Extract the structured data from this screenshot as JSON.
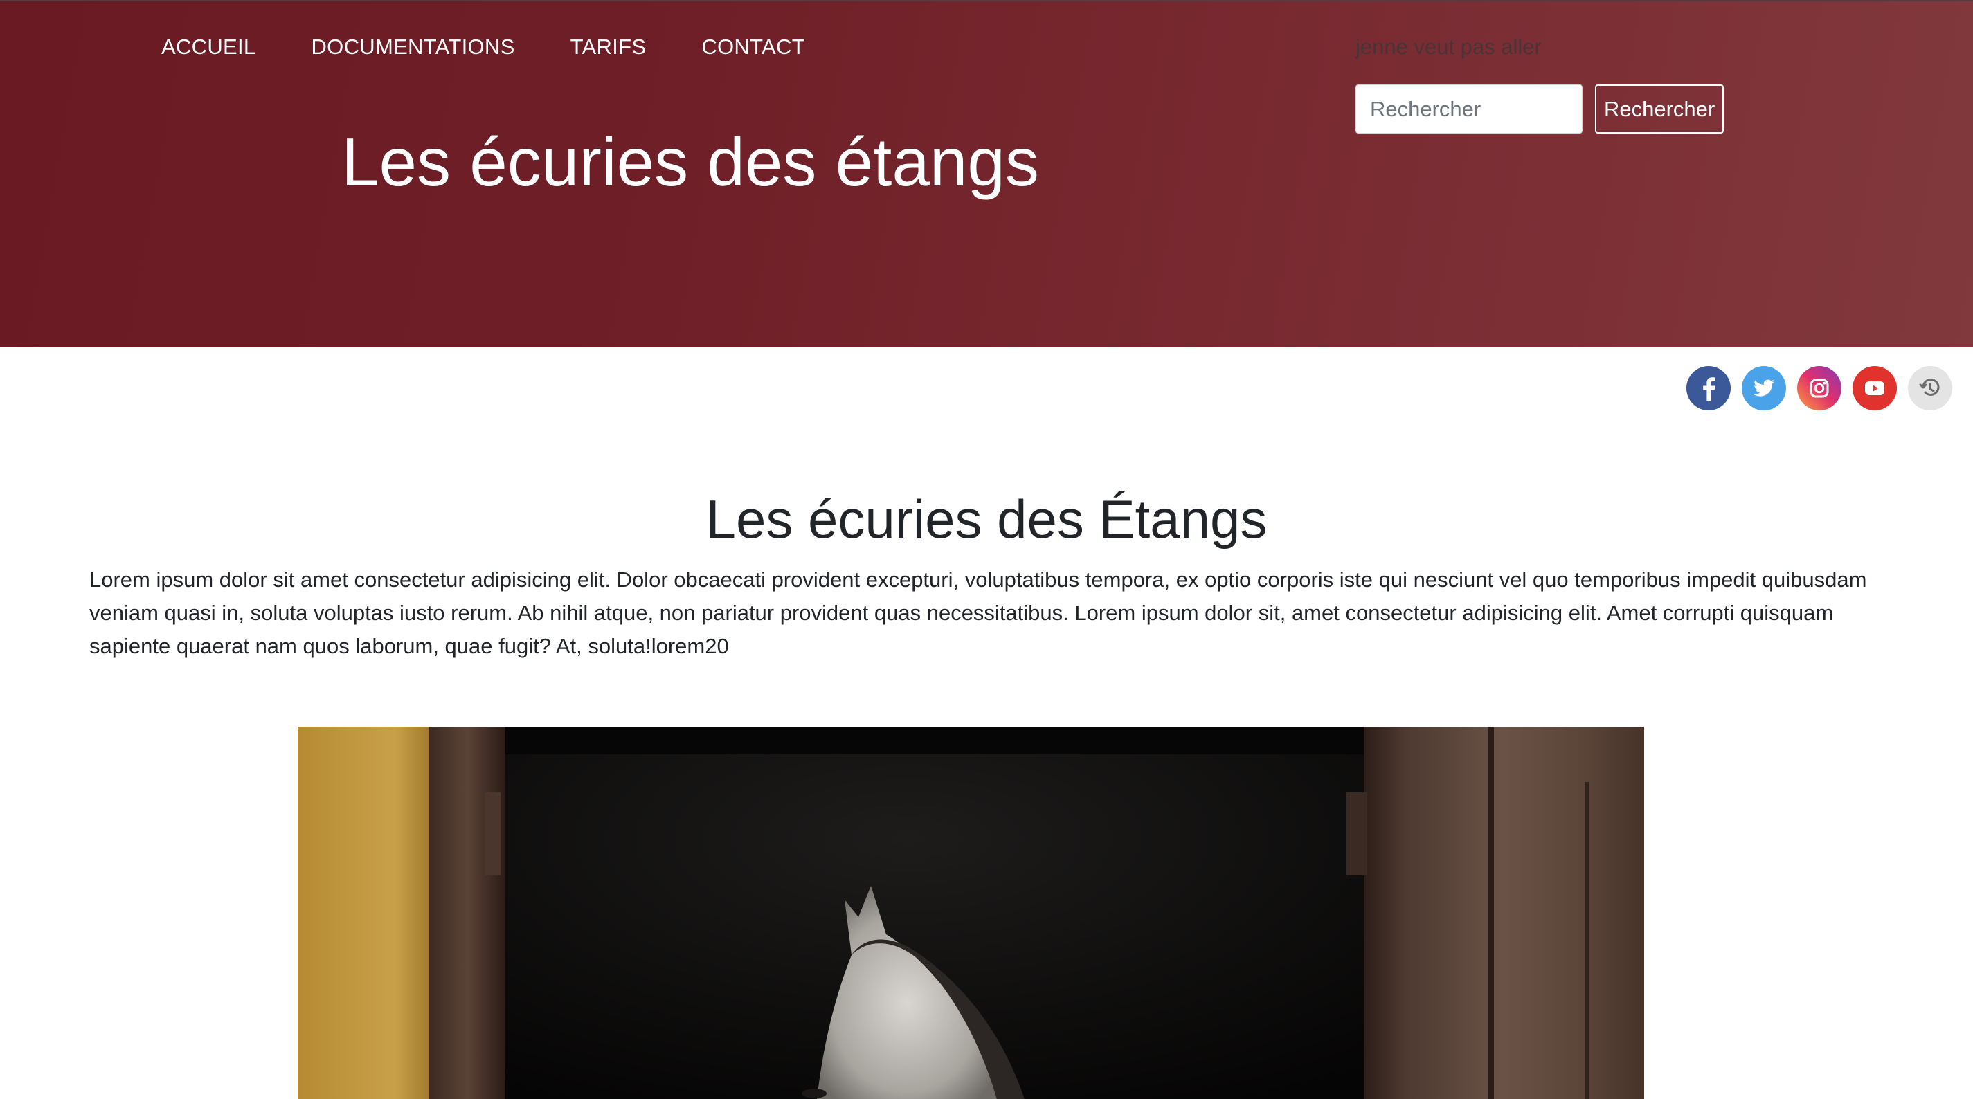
{
  "nav": {
    "items": [
      {
        "label": "ACCUEIL"
      },
      {
        "label": "DOCUMENTATIONS"
      },
      {
        "label": "TARIFS"
      },
      {
        "label": "CONTACT"
      }
    ]
  },
  "header": {
    "title": "Les écuries des étangs",
    "tagline": "jenne veut pas aller"
  },
  "search": {
    "placeholder": "Rechercher",
    "button_label": "Rechercher"
  },
  "social": [
    {
      "icon": "facebook-icon",
      "color": "#3b5998"
    },
    {
      "icon": "twitter-icon",
      "color": "#4aa3e8"
    },
    {
      "icon": "instagram-icon",
      "color": "#c13584"
    },
    {
      "icon": "youtube-icon",
      "color": "#e0332e"
    },
    {
      "icon": "history-icon",
      "color": "#e4e4e4"
    }
  ],
  "main": {
    "title": "Les écuries des Étangs",
    "intro": "Lorem ipsum dolor sit amet consectetur adipisicing elit. Dolor obcaecati provident excepturi, voluptatibus tempora, ex optio corporis iste qui nesciunt vel quo temporibus impedit quibusdam veniam quasi in, soluta voluptas iusto rerum. Ab nihil atque, non pariatur provident quas necessitatibus. Lorem ipsum dolor sit, amet consectetur adipisicing elit. Amet corrupti quisquam sapiente quaerat nam quos laborum, quae fugit? At, soluta!lorem20"
  },
  "colors": {
    "header_bg": "#6f1f27",
    "text": "#212529"
  }
}
